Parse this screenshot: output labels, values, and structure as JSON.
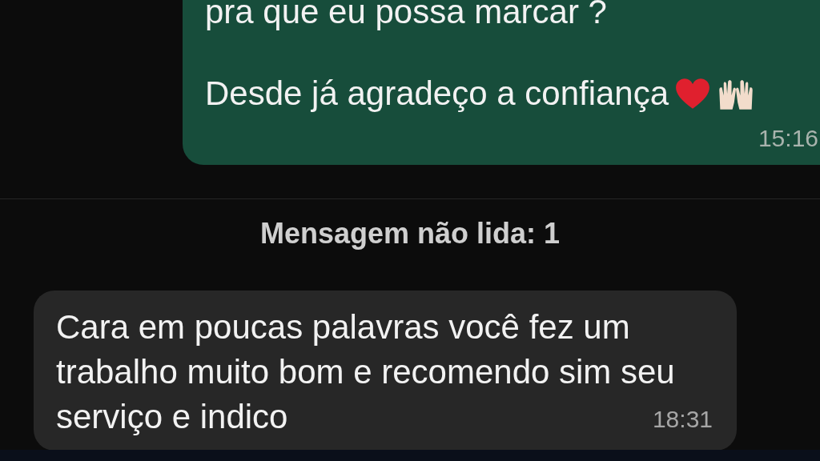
{
  "messages": [
    {
      "kind": "outgoing",
      "paragraphs": [
        "pra que eu possa marcar ?",
        "Desde já agradeço a confiança"
      ],
      "time": "15:16"
    },
    {
      "kind": "divider",
      "text": "Mensagem não lida: 1"
    },
    {
      "kind": "incoming",
      "paragraphs": [
        "Cara em poucas palavras você fez um",
        "trabalho muito bom e recomendo sim seu",
        "serviço e indico"
      ],
      "time": "18:31"
    }
  ]
}
